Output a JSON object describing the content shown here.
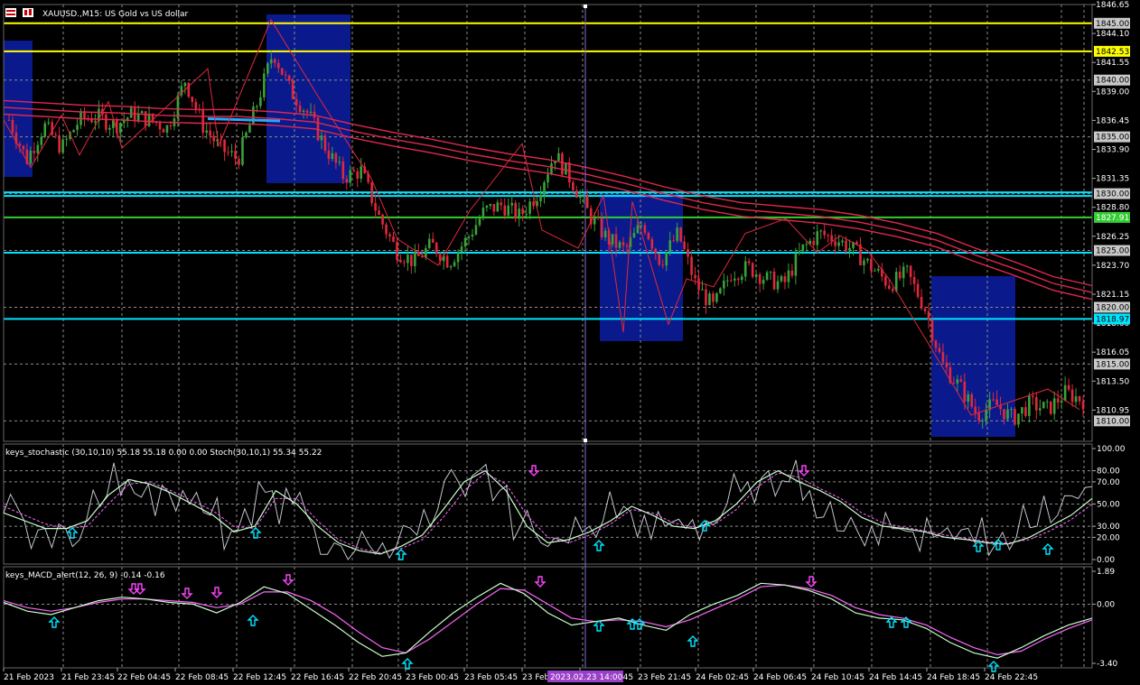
{
  "header": {
    "symbol_text": "XAUUSD.,M15:  US Gold vs US dollar"
  },
  "colors": {
    "bull": "#3aa13a",
    "bear": "#e0283c",
    "ma": "#e0284c",
    "ma_highlight": "#22aaff",
    "box": "#0a1a8c",
    "yellow": "#ffff00",
    "cyan": "#00e5ff",
    "green": "#33cc33",
    "zigzag": "#e0283c",
    "grid": "#8a8a8a",
    "vline": "#8a6ad8",
    "stoch_main": "#c8ffc8",
    "stoch_signal": "#ff66ff",
    "stoch_raw": "#c0c4cc",
    "macd_main": "#c8ffc8",
    "macd_signal": "#ff66ff",
    "arrow_up": "#00e5ff",
    "arrow_down": "#ff44ff"
  },
  "price_axis": {
    "min": 1808.2,
    "max": 1846.65,
    "ticks": [
      "1846.65",
      "1844.10",
      "1841.55",
      "1839.00",
      "1836.45",
      "1833.90",
      "1831.35",
      "1828.80",
      "1826.25",
      "1823.70",
      "1821.15",
      "1818.60",
      "1816.05",
      "1813.50",
      "1810.95"
    ],
    "grid_levels": [
      1845.0,
      1840.0,
      1835.0,
      1830.0,
      1825.0,
      1820.0,
      1815.0,
      1810.0
    ],
    "level_tags": [
      {
        "value": 1845.0,
        "text": "1845.00",
        "style": "gray"
      },
      {
        "value": 1840.0,
        "text": "1840.00",
        "style": "gray"
      },
      {
        "value": 1835.0,
        "text": "1835.00",
        "style": "gray"
      },
      {
        "value": 1830.0,
        "text": "1830.00",
        "style": "gray"
      },
      {
        "value": 1825.0,
        "text": "1825.00",
        "style": "gray"
      },
      {
        "value": 1820.0,
        "text": "1820.00",
        "style": "gray"
      },
      {
        "value": 1815.0,
        "text": "1815.00",
        "style": "gray"
      },
      {
        "value": 1810.0,
        "text": "1810.00",
        "style": "gray"
      },
      {
        "value": 1842.53,
        "text": "1842.53",
        "style": "yellow"
      },
      {
        "value": 1827.91,
        "text": "1827.91",
        "style": "green"
      },
      {
        "value": 1818.97,
        "text": "1818.97",
        "style": "cyan"
      }
    ],
    "hlines": [
      {
        "value": 1845.0,
        "color": "yellow"
      },
      {
        "value": 1842.53,
        "color": "yellow"
      },
      {
        "value": 1830.12,
        "color": "cyan"
      },
      {
        "value": 1829.8,
        "color": "cyan"
      },
      {
        "value": 1827.91,
        "color": "green"
      },
      {
        "value": 1824.8,
        "color": "cyan"
      },
      {
        "value": 1818.97,
        "color": "cyan"
      }
    ]
  },
  "time_axis": {
    "labels": [
      "21 Feb 2023",
      "21 Feb 23:45",
      "22 Feb 04:45",
      "22 Feb 08:45",
      "22 Feb 12:45",
      "22 Feb 16:45",
      "22 Feb 20:45",
      "23 Feb 00:45",
      "23 Feb 05:45",
      "23 Feb",
      "23 Feb 17:45",
      "23 Feb 21:45",
      "24 Feb 02:45",
      "24 Feb 06:45",
      "24 Feb 10:45",
      "24 Feb 14:45",
      "24 Feb 18:45",
      "24 Feb 22:45"
    ],
    "highlight_label": "2023.02.23 14:00"
  },
  "stoch_panel": {
    "title": "keys_stochastic (30,10,10) 55.18 55.18 0.00 0.00 Stoch(30,10,1) 55.34 55.22",
    "ticks": [
      "100.00",
      "80.00",
      "70.00",
      "50.00",
      "30.00",
      "20.00",
      "0.00"
    ]
  },
  "macd_panel": {
    "title": "keys_MACD_alert(12, 26, 9) -0.14 -0.16",
    "ticks": [
      "1.89",
      "0.00",
      "-3.40"
    ]
  },
  "chart_data": [
    {
      "type": "candlestick",
      "title": "XAUUSD.,M15:  US Gold vs US dollar",
      "ylim": [
        1808.2,
        1846.65
      ],
      "x_tick_labels": [
        "21 Feb 2023",
        "21 Feb 23:45",
        "22 Feb 04:45",
        "22 Feb 08:45",
        "22 Feb 12:45",
        "22 Feb 16:45",
        "22 Feb 20:45",
        "23 Feb 00:45",
        "23 Feb 05:45",
        "23 Feb",
        "23 Feb 17:45",
        "23 Feb 21:45",
        "24 Feb 02:45",
        "24 Feb 06:45",
        "24 Feb 10:45",
        "24 Feb 14:45",
        "24 Feb 18:45",
        "24 Feb 22:45"
      ],
      "close_path": [
        1836.5,
        1833.0,
        1836.0,
        1834.0,
        1836.5,
        1836.8,
        1836.0,
        1837.0,
        1836.5,
        1835.8,
        1840.0,
        1836.0,
        1834.0,
        1833.0,
        1837.5,
        1842.5,
        1839.0,
        1837.0,
        1834.0,
        1831.5,
        1832.0,
        1828.0,
        1825.0,
        1824.0,
        1825.5,
        1824.0,
        1826.0,
        1828.5,
        1829.0,
        1828.0,
        1830.0,
        1833.5,
        1831.0,
        1828.0,
        1826.0,
        1825.0,
        1827.5,
        1824.0,
        1826.5,
        1822.0,
        1820.0,
        1823.0,
        1823.5,
        1822.5,
        1822.0,
        1825.0,
        1826.5,
        1826.0,
        1825.0,
        1823.5,
        1822.0,
        1823.0,
        1820.0,
        1815.0,
        1813.0,
        1810.5,
        1811.5,
        1810.2,
        1811.5,
        1811.0,
        1812.5,
        1811.8
      ],
      "zigzag": [
        [
          0,
          1836.5
        ],
        [
          1,
          1832.3
        ],
        [
          2,
          1836.9
        ],
        [
          3,
          1833.4
        ],
        [
          4,
          1838.1
        ],
        [
          5,
          1834.0
        ],
        [
          6,
          1841.0
        ],
        [
          7,
          1834.2
        ],
        [
          8,
          1845.3
        ],
        [
          9,
          1838.2
        ],
        [
          10,
          1833.2
        ],
        [
          11,
          1831.5
        ],
        [
          12,
          1826.0
        ],
        [
          13,
          1823.7
        ],
        [
          14,
          1828.5
        ],
        [
          15,
          1834.4
        ],
        [
          16,
          1826.8
        ],
        [
          17,
          1825.2
        ],
        [
          18,
          1829.8
        ],
        [
          19,
          1817.8
        ],
        [
          20,
          1829.3
        ],
        [
          21,
          1818.5
        ],
        [
          22,
          1822.5
        ],
        [
          23,
          1821.8
        ],
        [
          24,
          1826.5
        ],
        [
          25,
          1827.8
        ],
        [
          26,
          1824.8
        ],
        [
          27,
          1826.3
        ],
        [
          28,
          1825.0
        ],
        [
          29,
          1822.4
        ],
        [
          30,
          1816.5
        ],
        [
          31,
          1810.5
        ],
        [
          32,
          1812.8
        ],
        [
          33,
          1811.0
        ]
      ],
      "ma_path": [
        1837.3,
        1837.1,
        1836.9,
        1836.8,
        1836.6,
        1836.5,
        1836.5,
        1836.3,
        1836.0,
        1835.2,
        1834.5,
        1833.9,
        1833.2,
        1832.6,
        1832.1,
        1831.4,
        1830.6,
        1829.7,
        1828.9,
        1828.3,
        1828.0,
        1827.7,
        1827.2,
        1826.5,
        1825.6,
        1824.3,
        1823.1,
        1821.8,
        1821.0
      ]
    },
    {
      "type": "line",
      "title": "keys_stochastic (30,10,10) 55.18 55.18 0.00 0.00 Stoch(30,10,1) 55.34 55.22",
      "ylim": [
        0,
        100
      ],
      "series": [
        {
          "name": "keys_stochastic",
          "values": [
            42,
            35,
            28,
            28,
            35,
            58,
            72,
            68,
            60,
            50,
            40,
            25,
            30,
            62,
            50,
            30,
            15,
            8,
            5,
            12,
            22,
            45,
            70,
            80,
            62,
            30,
            15,
            18,
            25,
            35,
            48,
            40,
            30,
            28,
            35,
            50,
            70,
            80,
            70,
            62,
            52,
            38,
            30,
            28,
            25,
            20,
            18,
            15,
            14,
            20,
            30,
            40,
            55
          ]
        },
        {
          "name": "Stoch",
          "values": [
            48,
            40,
            32,
            28,
            30,
            50,
            68,
            70,
            62,
            53,
            44,
            30,
            28,
            55,
            55,
            35,
            18,
            10,
            6,
            10,
            18,
            38,
            62,
            78,
            68,
            40,
            20,
            15,
            22,
            32,
            45,
            42,
            33,
            29,
            32,
            45,
            65,
            78,
            74,
            64,
            55,
            42,
            33,
            29,
            26,
            22,
            19,
            16,
            15,
            18,
            26,
            36,
            50
          ]
        }
      ]
    },
    {
      "type": "line",
      "title": "keys_MACD_alert(12, 26, 9) -0.14 -0.16",
      "ylim": [
        -3.4,
        1.89
      ],
      "series": [
        {
          "name": "keys_MACD_alert",
          "values": [
            0.1,
            -0.4,
            -0.6,
            -0.2,
            0.2,
            0.4,
            0.3,
            0.1,
            0.0,
            -0.5,
            0.1,
            1.0,
            0.6,
            -0.3,
            -1.2,
            -2.2,
            -3.0,
            -2.8,
            -1.6,
            -0.5,
            0.4,
            1.2,
            0.6,
            -0.5,
            -1.2,
            -1.0,
            -0.8,
            -1.2,
            -1.5,
            -0.6,
            0.0,
            0.5,
            1.2,
            1.1,
            0.8,
            0.3,
            -0.5,
            -0.8,
            -0.9,
            -1.4,
            -2.2,
            -2.8,
            -3.1,
            -2.5,
            -1.8,
            -1.2,
            -0.8
          ]
        },
        {
          "name": "signal",
          "values": [
            0.2,
            -0.2,
            -0.4,
            -0.2,
            0.1,
            0.3,
            0.3,
            0.2,
            0.1,
            -0.2,
            0.0,
            0.7,
            0.7,
            0.2,
            -0.6,
            -1.6,
            -2.5,
            -2.8,
            -2.0,
            -1.0,
            0.0,
            0.9,
            0.8,
            0.0,
            -0.8,
            -1.0,
            -0.9,
            -1.0,
            -1.3,
            -0.9,
            -0.3,
            0.3,
            1.0,
            1.1,
            0.9,
            0.5,
            -0.2,
            -0.6,
            -0.8,
            -1.2,
            -1.9,
            -2.5,
            -2.9,
            -2.7,
            -2.0,
            -1.4,
            -0.9
          ]
        }
      ]
    }
  ]
}
